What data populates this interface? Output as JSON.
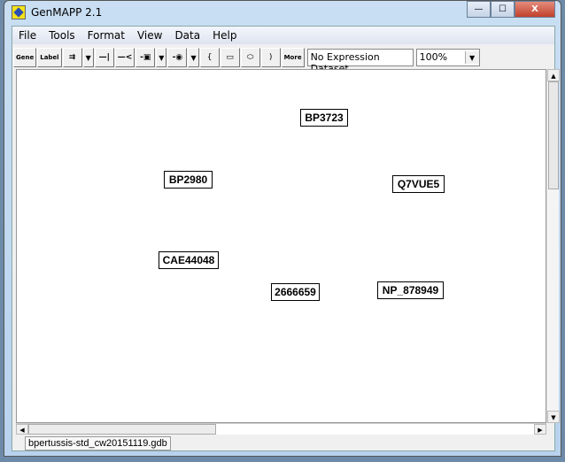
{
  "window": {
    "title": "GenMAPP 2.1",
    "minimize": "—",
    "maximize": "☐",
    "close": "X"
  },
  "menu": [
    "File",
    "Tools",
    "Format",
    "View",
    "Data",
    "Help"
  ],
  "toolbar": {
    "gene": "Gene",
    "label": "Label",
    "more": "More",
    "expression_dataset": "No Expression Dataset",
    "zoom": "100%"
  },
  "genes": [
    "BP3723",
    "BP2980",
    "Q7VUE5",
    "CAE44048",
    "2666659",
    "NP_878949"
  ],
  "status": {
    "file": "bpertussis-std_cw20151119.gdb"
  }
}
